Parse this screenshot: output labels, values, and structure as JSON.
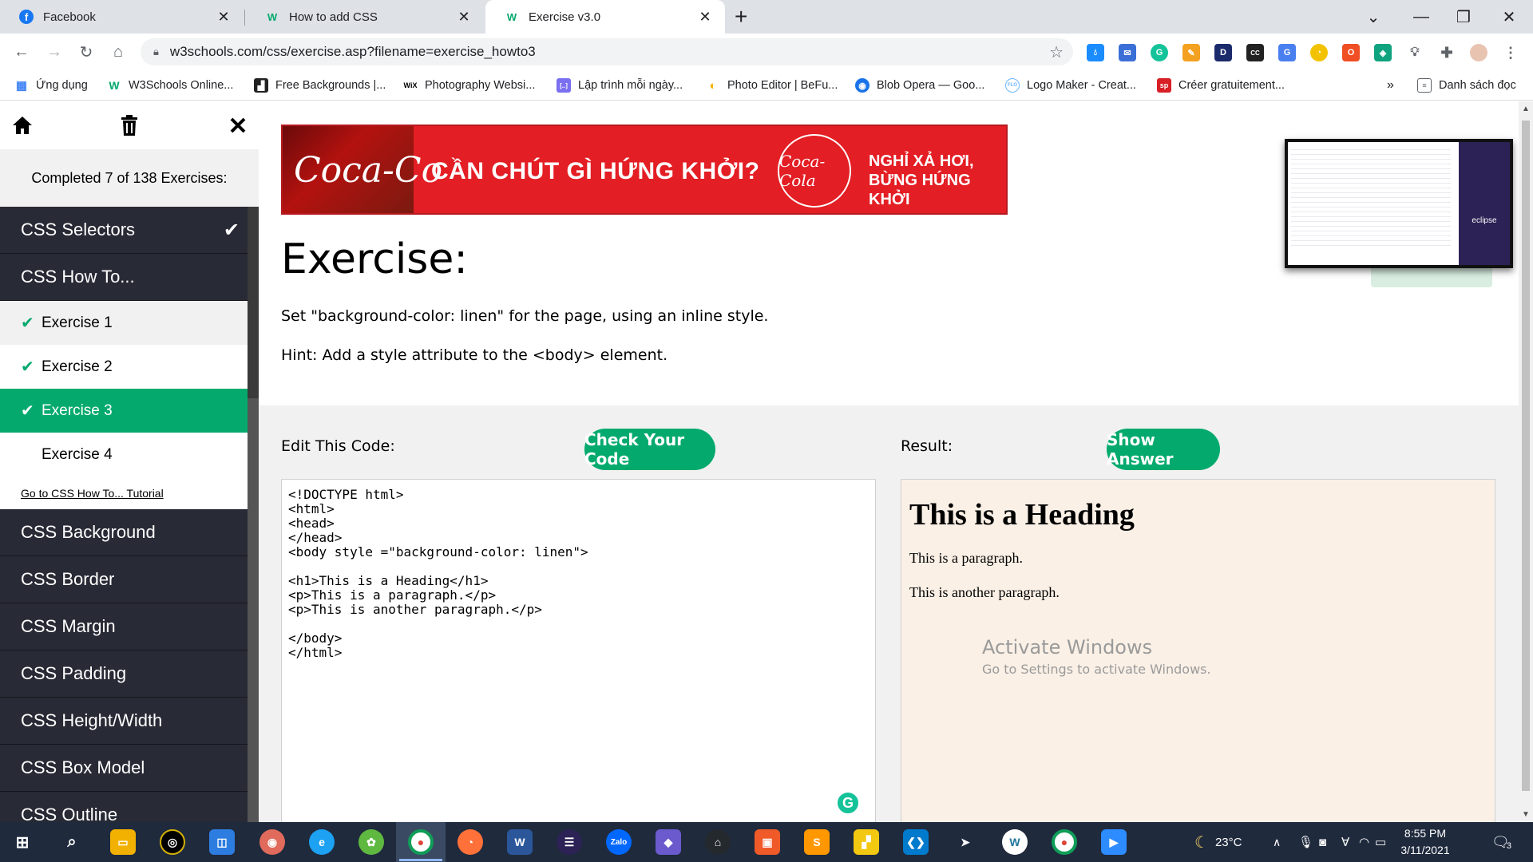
{
  "browser": {
    "tabs": [
      {
        "title": "Facebook",
        "icon": "facebook-icon",
        "color": "#1877f2",
        "glyph": "f"
      },
      {
        "title": "How to add CSS",
        "icon": "w3schools-icon",
        "color": "#04aa6d",
        "glyph": "W"
      },
      {
        "title": "Exercise v3.0",
        "icon": "w3schools-icon",
        "color": "#04aa6d",
        "glyph": "W"
      }
    ],
    "new_tab": "+",
    "address": "w3schools.com/css/exercise.asp?filename=exercise_howto3",
    "bookmarks": [
      {
        "label": "Ứng dụng",
        "color": "#4285f4",
        "glyph": "▦"
      },
      {
        "label": "W3Schools Online...",
        "color": "#04aa6d",
        "glyph": "W"
      },
      {
        "label": "Free Backgrounds |...",
        "color": "#222222",
        "glyph": "▟"
      },
      {
        "label": "Photography Websi...",
        "color": "#000000",
        "glyph": "WiX"
      },
      {
        "label": "Lập trình mỗi ngày...",
        "color": "#7a6ff0",
        "glyph": "[..]"
      },
      {
        "label": "Photo Editor | BeFu...",
        "color": "#f4b400",
        "glyph": "◐"
      },
      {
        "label": "Blob Opera — Goo...",
        "color": "#1a73e8",
        "glyph": "◉"
      },
      {
        "label": "Logo Maker - Creat...",
        "color": "#6ab7ff",
        "glyph": "FLO"
      },
      {
        "label": "Créer gratuitement...",
        "color": "#d81f26",
        "glyph": "sp"
      }
    ],
    "bookmarks_more": "»",
    "reading_list": "Danh sách đọc"
  },
  "sidebar": {
    "completed_text": "Completed 7 of 138 Exercises:",
    "sections_top": [
      {
        "label": "CSS Selectors",
        "checked": true
      },
      {
        "label": "CSS How To...",
        "checked": false
      }
    ],
    "sub_items": [
      {
        "label": "Exercise 1",
        "state": "done"
      },
      {
        "label": "Exercise 2",
        "state": "done"
      },
      {
        "label": "Exercise 3",
        "state": "active"
      },
      {
        "label": "Exercise 4",
        "state": "todo"
      }
    ],
    "tutorial_link": "Go to CSS How To... Tutorial",
    "sections_bottom": [
      "CSS Background",
      "CSS Border",
      "CSS Margin",
      "CSS Padding",
      "CSS Height/Width",
      "CSS Box Model",
      "CSS Outline"
    ]
  },
  "ad": {
    "brand": "Coca-Co",
    "headline": "CẦN CHÚT GÌ HỨNG KHỞI?",
    "logo_text": "Coca-Cola",
    "slogan_line1": "NGHỈ XẢ HƠI,",
    "slogan_line2": "BỪNG HỨNG KHỞI"
  },
  "thumbnail": {
    "label": "eclipse"
  },
  "exercise": {
    "title": "Exercise:",
    "description": "Set \"background-color: linen\" for the page, using an inline style.",
    "hint": "Hint: Add a style attribute to the <body> element.",
    "edit_label": "Edit This Code:",
    "check_button": "Check Your Code",
    "result_label": "Result:",
    "answer_button": "Show Answer",
    "code_lines": [
      "<!DOCTYPE html>",
      "<html>",
      "<head>",
      "</head>",
      "<body style =\"background-color: linen\">",
      "",
      "<h1>This is a Heading</h1>",
      "<p>This is a paragraph.</p>",
      "<p>This is another paragraph.</p>",
      "",
      "</body>",
      "</html>"
    ],
    "result_heading": "This is a Heading",
    "result_p1": "This is a paragraph.",
    "result_p2": "This is another paragraph.",
    "result_bg": "#faf0e6"
  },
  "watermark": {
    "line1": "Activate Windows",
    "line2": "Go to Settings to activate Windows."
  },
  "taskbar": {
    "temperature": "23°C",
    "time": "8:55 PM",
    "date": "3/11/2021",
    "notifications": "3"
  },
  "colors": {
    "accent": "#04aa6d",
    "sidebar_bg": "#282a35"
  }
}
